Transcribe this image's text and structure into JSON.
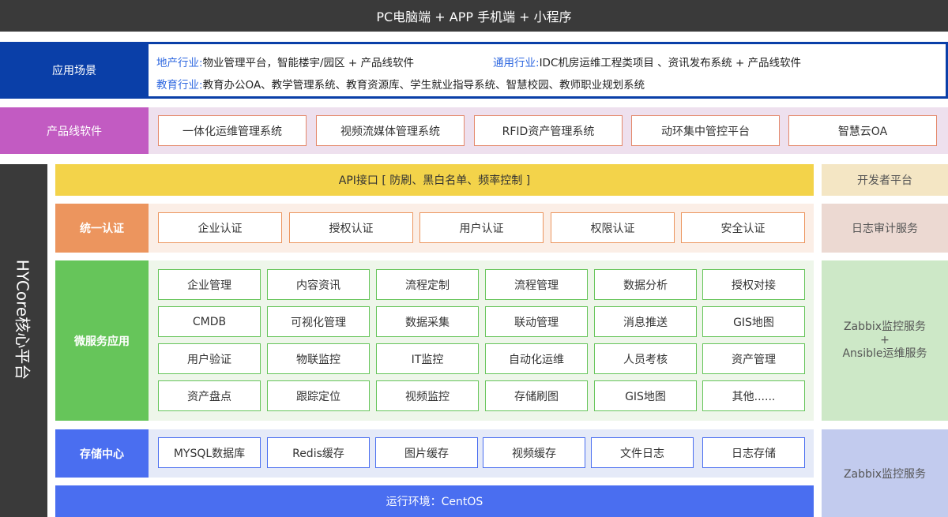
{
  "top_bar": {
    "title": "PC电脑端 + APP 手机端 + 小程序"
  },
  "scene": {
    "label": "应用场景",
    "realestate_key": "地产行业:",
    "realestate_value": "物业管理平台，智能楼宇/园区  + 产品线软件",
    "general_key": "通用行业:",
    "general_value": "IDC机房运维工程类项目 、资讯发布系统 + 产品线软件",
    "education_key": "教育行业:",
    "education_value": "教育办公OA、教学管理系统、教育资源库、学生就业指导系统、智慧校园、教师职业规划系统"
  },
  "product_line": {
    "label": "产品线软件",
    "items": [
      "一体化运维管理系统",
      "视频流媒体管理系统",
      "RFID资产管理系统",
      "动环集中管控平台",
      "智慧云OA"
    ]
  },
  "core": {
    "label": "HYCore核心平台"
  },
  "api": {
    "label": "API接口 [ 防刷、黑白名单、频率控制 ]"
  },
  "dev_platform": {
    "label": "开发者平台"
  },
  "auth": {
    "label": "统一认证",
    "items": [
      "企业认证",
      "授权认证",
      "用户认证",
      "权限认证",
      "安全认证"
    ]
  },
  "log_audit": {
    "label": "日志审计服务"
  },
  "microservice": {
    "label": "微服务应用",
    "rows": [
      [
        "企业管理",
        "内容资讯",
        "流程定制",
        "流程管理",
        "数据分析",
        "授权对接"
      ],
      [
        "CMDB",
        "可视化管理",
        "数据采集",
        "联动管理",
        "消息推送",
        "GIS地图"
      ],
      [
        "用户验证",
        "物联监控",
        "IT监控",
        "自动化运维",
        "人员考核",
        "资产管理"
      ],
      [
        "资产盘点",
        "跟踪定位",
        "视频监控",
        "存储刷图",
        "GIS地图",
        "其他......"
      ]
    ]
  },
  "ops_service": {
    "line1": "Zabbix监控服务",
    "plus": "+",
    "line2": "Ansible运维服务"
  },
  "storage": {
    "label": "存储中心",
    "items": [
      "MYSQL数据库",
      "Redis缓存",
      "图片缓存",
      "视频缓存",
      "文件日志",
      "日志存储"
    ]
  },
  "monitor_service": {
    "label": "Zabbix监控服务"
  },
  "runtime": {
    "label": "运行环境：CentOS"
  },
  "colors": {
    "dark": "#3a3a3a",
    "scene_blue": "#0a3fa8",
    "product_purple": "#c25bc2",
    "api_yellow": "#f3d34a",
    "auth_orange": "#ec955e",
    "micro_green": "#66c55a",
    "storage_blue": "#4a6ef0"
  }
}
